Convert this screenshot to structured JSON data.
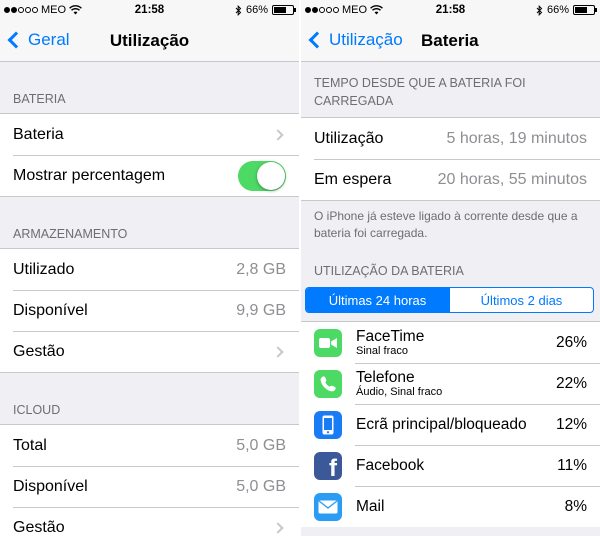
{
  "status": {
    "carrier": "MEO",
    "time": "21:58",
    "battery": "66%"
  },
  "left": {
    "nav": {
      "back": "Geral",
      "title": "Utilização"
    },
    "sections": [
      {
        "header": "BATERIA"
      },
      {
        "header": "ARMAZENAMENTO"
      },
      {
        "header": "ICLOUD"
      }
    ],
    "bateria_row": "Bateria",
    "percentage_row": "Mostrar percentagem",
    "percentage_on": true,
    "storage": [
      {
        "label": "Utilizado",
        "value": "2,8 GB"
      },
      {
        "label": "Disponível",
        "value": "9,9 GB"
      },
      {
        "label": "Gestão"
      }
    ],
    "icloud": [
      {
        "label": "Total",
        "value": "5,0 GB"
      },
      {
        "label": "Disponível",
        "value": "5,0 GB"
      },
      {
        "label": "Gestão"
      }
    ]
  },
  "right": {
    "nav": {
      "back": "Utilização",
      "title": "Bateria"
    },
    "time_header": "TEMPO DESDE QUE A BATERIA FOI CARREGADA",
    "time_rows": [
      {
        "label": "Utilização",
        "value": "5 horas, 19 minutos"
      },
      {
        "label": "Em espera",
        "value": "20 horas, 55 minutos"
      }
    ],
    "footnote": "O iPhone já esteve ligado à corrente desde que a bateria foi carregada.",
    "usage_header": "UTILIZAÇÃO DA BATERIA",
    "segments": [
      "Últimas 24 horas",
      "Últimos 2 dias"
    ],
    "apps": [
      {
        "name": "FaceTime",
        "sub": "Sinal fraco",
        "pct": "26%",
        "icon": "facetime-icon",
        "color": "#4cd964"
      },
      {
        "name": "Telefone",
        "sub": "Áudio, Sinal fraco",
        "pct": "22%",
        "icon": "phone-icon",
        "color": "#4cd964"
      },
      {
        "name": "Ecrã principal/bloqueado",
        "sub": "",
        "pct": "12%",
        "icon": "home-screen-icon",
        "color": "#1a7cf5"
      },
      {
        "name": "Facebook",
        "sub": "",
        "pct": "11%",
        "icon": "facebook-icon",
        "color": "#3b5998"
      },
      {
        "name": "Mail",
        "sub": "",
        "pct": "8%",
        "icon": "mail-icon",
        "color": "#2a9cf4"
      }
    ]
  }
}
